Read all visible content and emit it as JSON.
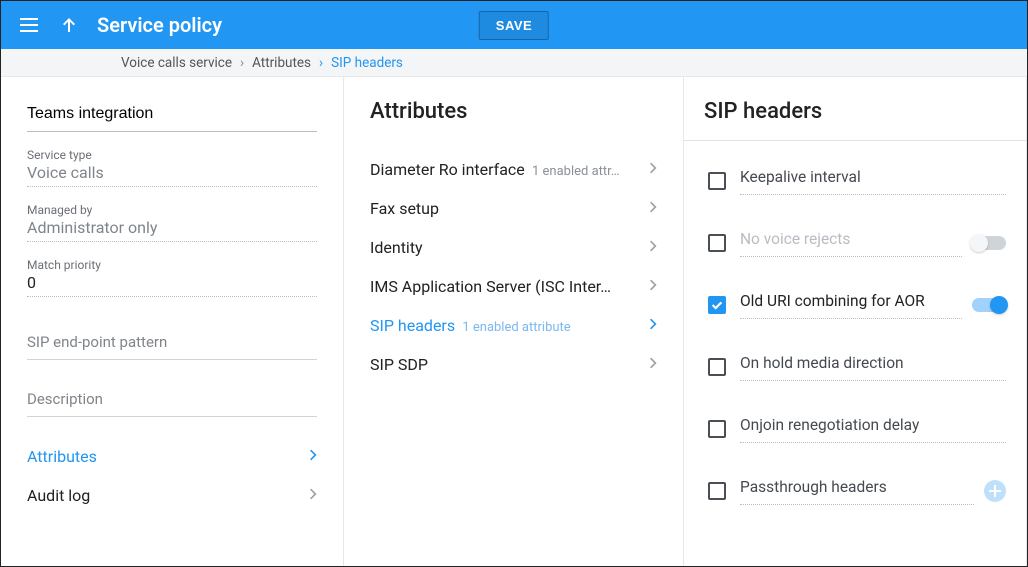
{
  "header": {
    "title": "Service policy",
    "save_label": "SAVE"
  },
  "breadcrumb": {
    "items": [
      "Voice calls service",
      "Attributes",
      "SIP headers"
    ],
    "active_index": 2
  },
  "left_panel": {
    "name_value": "Teams integration",
    "fields": [
      {
        "label": "Service type",
        "value": "Voice calls",
        "readonly": true
      },
      {
        "label": "Managed by",
        "value": "Administrator only",
        "readonly": true
      },
      {
        "label": "Match priority",
        "value": "0",
        "readonly": false
      }
    ],
    "sip_pattern_placeholder": "SIP end-point pattern",
    "description_placeholder": "Description",
    "nav": [
      {
        "label": "Attributes",
        "active": true
      },
      {
        "label": "Audit log",
        "active": false
      }
    ]
  },
  "middle_panel": {
    "title": "Attributes",
    "items": [
      {
        "label": "Diameter Ro interface",
        "sub": "1 enabled attr…",
        "active": false
      },
      {
        "label": "Fax setup",
        "sub": "",
        "active": false
      },
      {
        "label": "Identity",
        "sub": "",
        "active": false
      },
      {
        "label": "IMS Application Server (ISC Inter…",
        "sub": "",
        "active": false
      },
      {
        "label": "SIP headers",
        "sub": "1 enabled attribute",
        "active": true
      },
      {
        "label": "SIP SDP",
        "sub": "",
        "active": false
      }
    ]
  },
  "right_panel": {
    "title": "SIP headers",
    "items": [
      {
        "label": "Keepalive interval",
        "checked": false,
        "disabled": false,
        "toggle": null,
        "add": false
      },
      {
        "label": "No voice rejects",
        "checked": false,
        "disabled": true,
        "toggle": false,
        "add": false
      },
      {
        "label": "Old URI combining for AOR",
        "checked": true,
        "disabled": false,
        "toggle": true,
        "add": false
      },
      {
        "label": "On hold media direction",
        "checked": false,
        "disabled": false,
        "toggle": null,
        "add": false
      },
      {
        "label": "Onjoin renegotiation delay",
        "checked": false,
        "disabled": false,
        "toggle": null,
        "add": false
      },
      {
        "label": "Passthrough headers",
        "checked": false,
        "disabled": false,
        "toggle": null,
        "add": true
      }
    ]
  },
  "colors": {
    "accent": "#2196f3"
  }
}
